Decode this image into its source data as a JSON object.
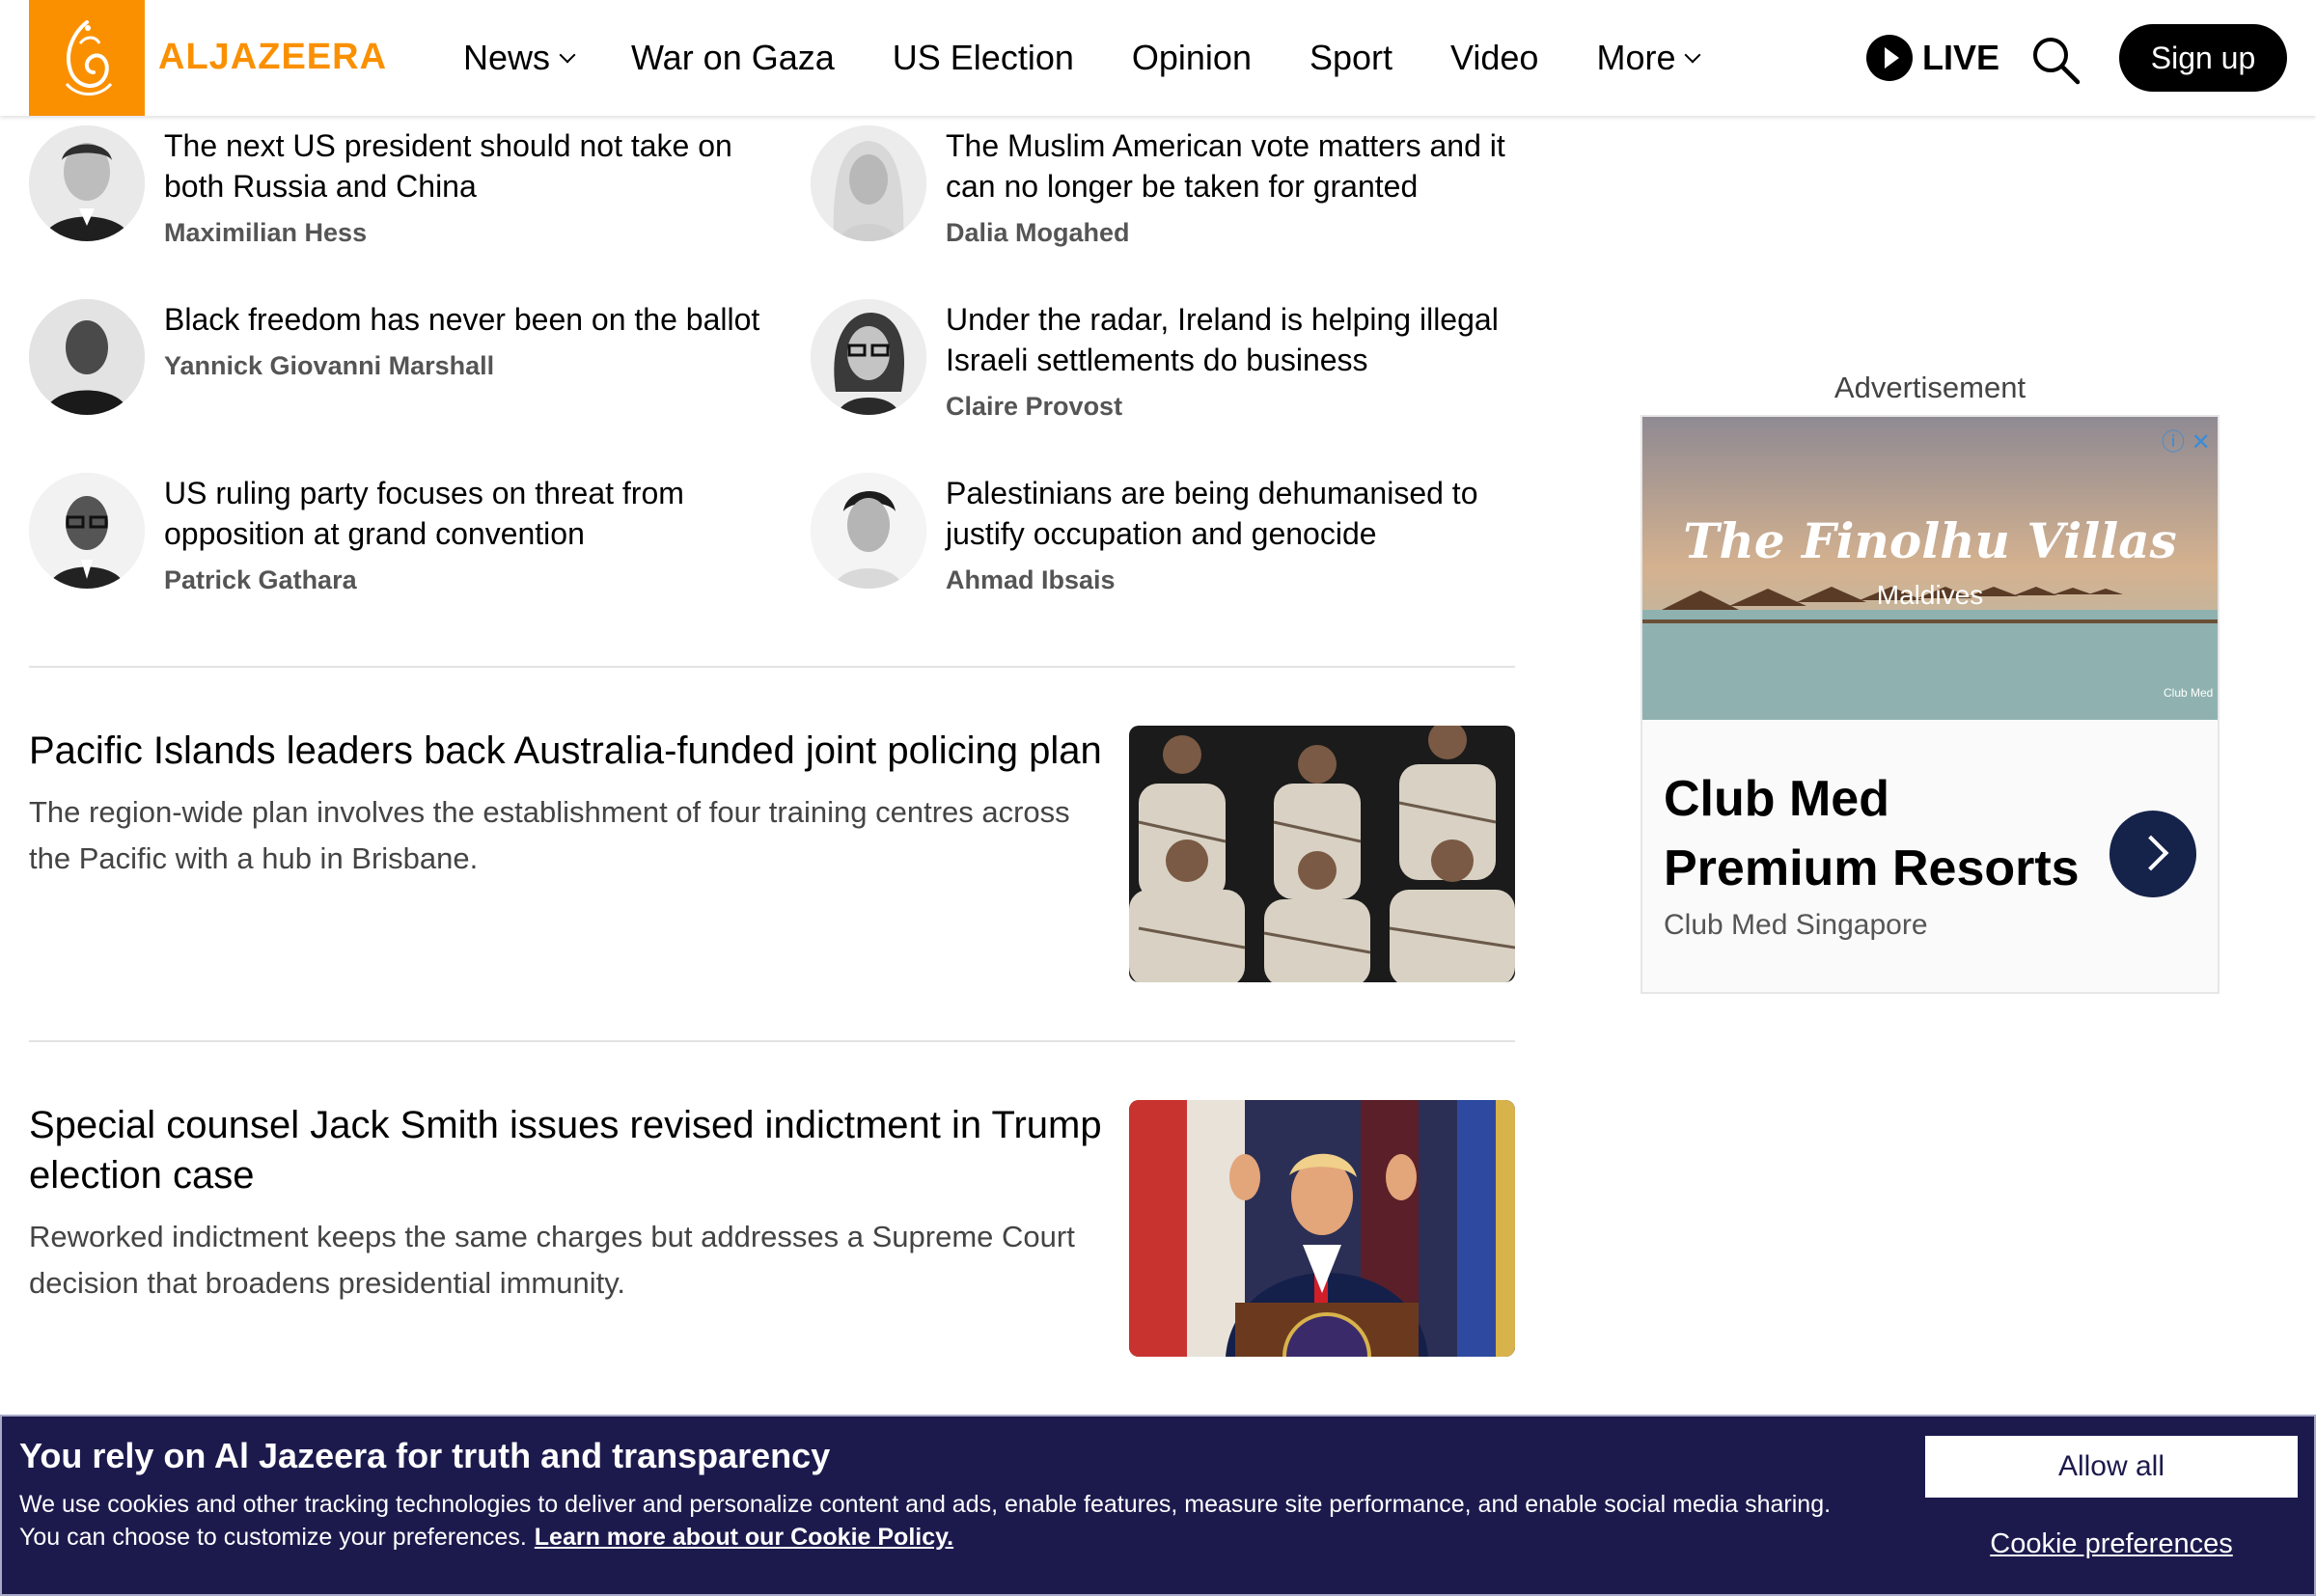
{
  "header": {
    "brand": "ALJAZEERA",
    "nav": [
      {
        "label": "News",
        "dropdown": true
      },
      {
        "label": "War on Gaza",
        "dropdown": false
      },
      {
        "label": "US Election",
        "dropdown": false
      },
      {
        "label": "Opinion",
        "dropdown": false
      },
      {
        "label": "Sport",
        "dropdown": false
      },
      {
        "label": "Video",
        "dropdown": false
      },
      {
        "label": "More",
        "dropdown": true
      }
    ],
    "live_label": "LIVE",
    "signup_label": "Sign up"
  },
  "opinions": [
    {
      "title": "The next US president should not take on both Russia and China",
      "author": "Maximilian Hess"
    },
    {
      "title": "The Muslim American vote matters and it can no longer be taken for granted",
      "author": "Dalia Mogahed"
    },
    {
      "title": "Black freedom has never been on the ballot",
      "author": "Yannick Giovanni Marshall"
    },
    {
      "title": "Under the radar, Ireland is helping illegal Israeli settlements do business",
      "author": "Claire Provost"
    },
    {
      "title": "US ruling party focuses on threat from opposition at grand convention",
      "author": "Patrick Gathara"
    },
    {
      "title": "Palestinians are being dehumanised to justify occupation and genocide",
      "author": "Ahmad Ibsais"
    }
  ],
  "stories": [
    {
      "title": "Pacific Islands leaders back Australia-funded joint policing plan",
      "desc": "The region-wide plan involves the establishment of four training centres across the Pacific with a hub in Brisbane."
    },
    {
      "title": "Special counsel Jack Smith issues revised indictment in Trump election case",
      "desc": "Reworked indictment keeps the same charges but addresses a Supreme Court decision that broadens presidential immunity."
    }
  ],
  "ad": {
    "label": "Advertisement",
    "image_title": "The Finolhu Villas",
    "image_subtitle": "Maldives",
    "image_logo": "Club Med",
    "heading": "Club Med Premium Resorts",
    "advertiser": "Club Med Singapore"
  },
  "cookie": {
    "title": "You rely on Al Jazeera for truth and transparency",
    "body": "We use cookies and other tracking technologies to deliver and personalize content and ads, enable features, measure site performance, and enable social media sharing. You can choose to customize your preferences.",
    "link": "Learn more about our Cookie Policy.",
    "allow_label": "Allow all",
    "prefs_label": "Cookie preferences"
  },
  "colors": {
    "brand": "#fa9000",
    "banner": "#1c1a4d",
    "ad_button": "#15224a"
  }
}
